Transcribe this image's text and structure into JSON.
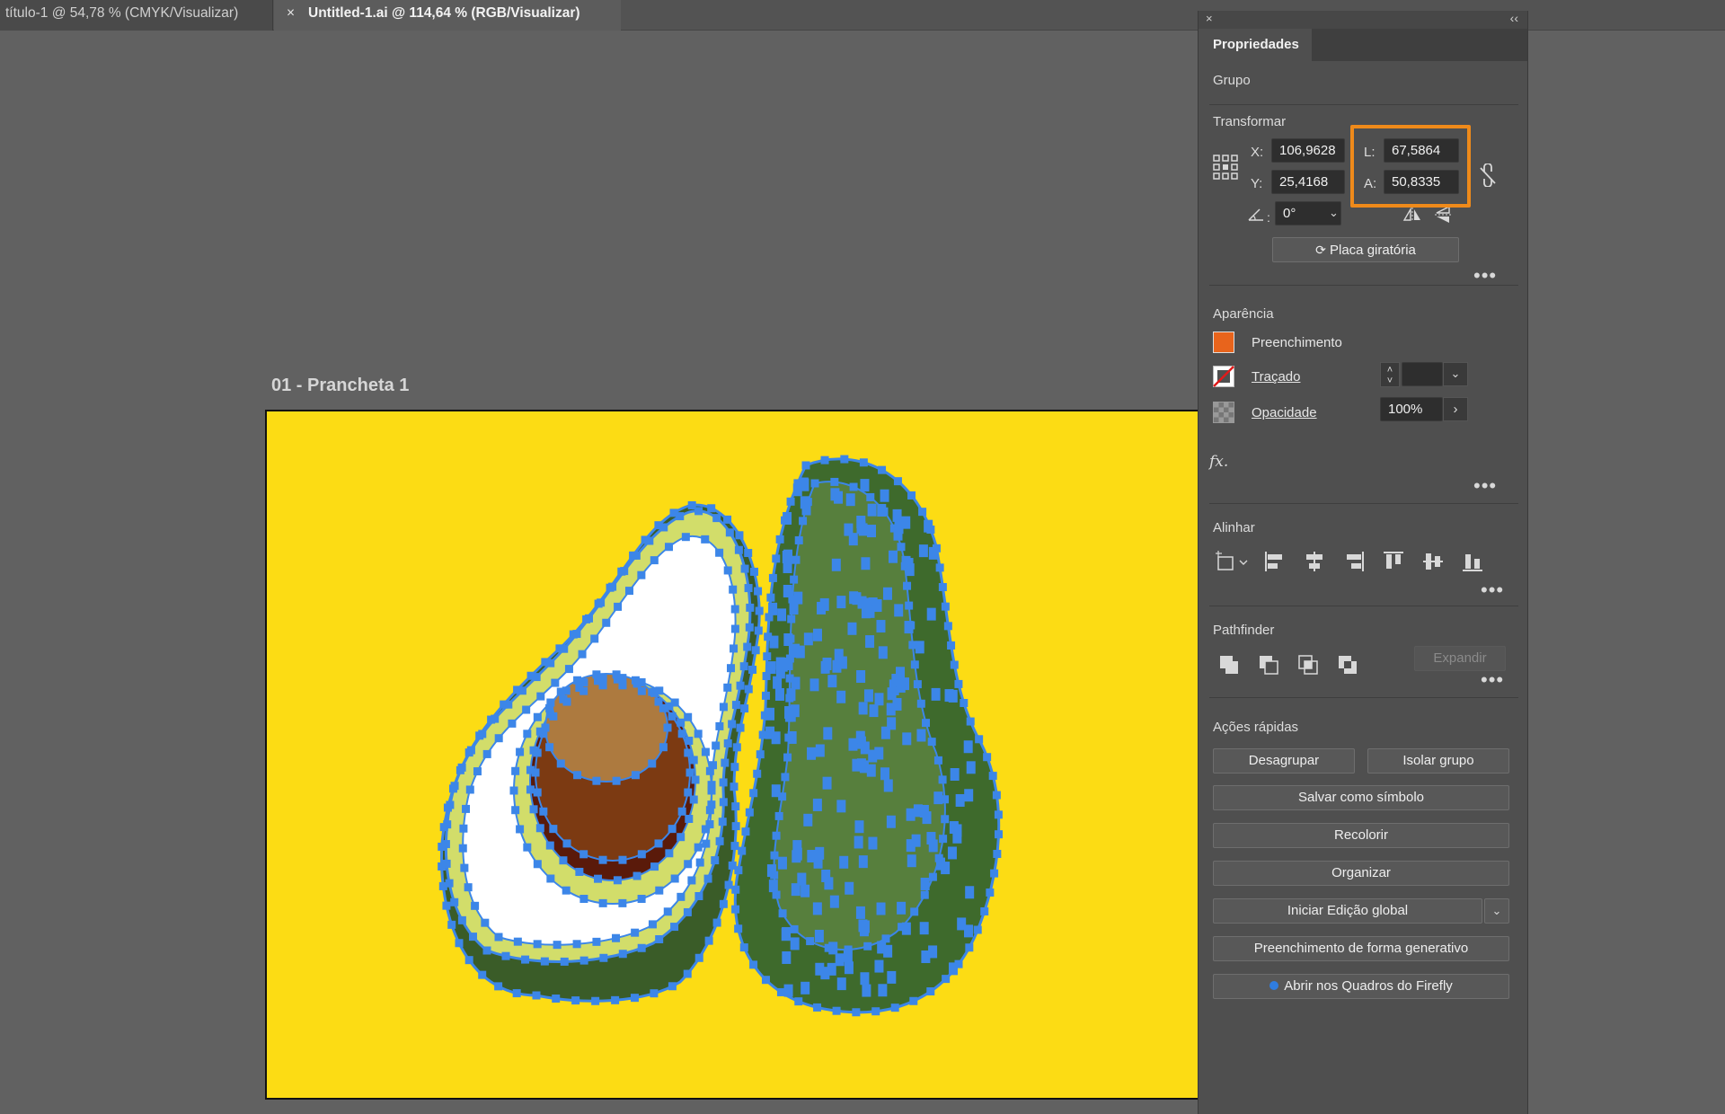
{
  "tabs": [
    {
      "label": "título-1 @ 54,78 % (CMYK/Visualizar)",
      "active": false
    },
    {
      "label": "Untitled-1.ai @ 114,64 % (RGB/Visualizar)",
      "active": true,
      "close": "×"
    }
  ],
  "artboard": {
    "label": "01 - Prancheta 1",
    "background": "#fcdc14"
  },
  "panel": {
    "tab": "Propriedades",
    "close": "×",
    "collapse": "‹‹",
    "selection_type": "Grupo",
    "transform": {
      "title": "Transformar",
      "x_label": "X:",
      "x_value": "106,9628",
      "y_label": "Y:",
      "y_value": "25,4168",
      "w_label": "L:",
      "w_value": "67,5864",
      "h_label": "A:",
      "h_value": "50,8335",
      "angle_value": "0°",
      "rotate_button": "Placa giratória"
    },
    "appearance": {
      "title": "Aparência",
      "fill_label": "Preenchimento",
      "fill_color": "#e8641c",
      "stroke_label": "Traçado",
      "opacity_label": "Opacidade",
      "opacity_value": "100%",
      "fx": "fx."
    },
    "align": {
      "title": "Alinhar"
    },
    "pathfinder": {
      "title": "Pathfinder",
      "expand_button": "Expandir"
    },
    "quick_actions": {
      "title": "Ações rápidas",
      "ungroup": "Desagrupar",
      "isolate": "Isolar grupo",
      "save_symbol": "Salvar como símbolo",
      "recolor": "Recolorir",
      "arrange": "Organizar",
      "global_edit": "Iniciar Edição global",
      "generative_fill": "Preenchimento de forma generativo",
      "firefly": "Abrir nos Quadros do Firefly"
    },
    "more": "•••"
  },
  "colors": {
    "selection": "#3c86e8",
    "highlight": "#ef8a1a",
    "panel_bg": "#4f4f4f",
    "canvas_bg": "#616161"
  }
}
